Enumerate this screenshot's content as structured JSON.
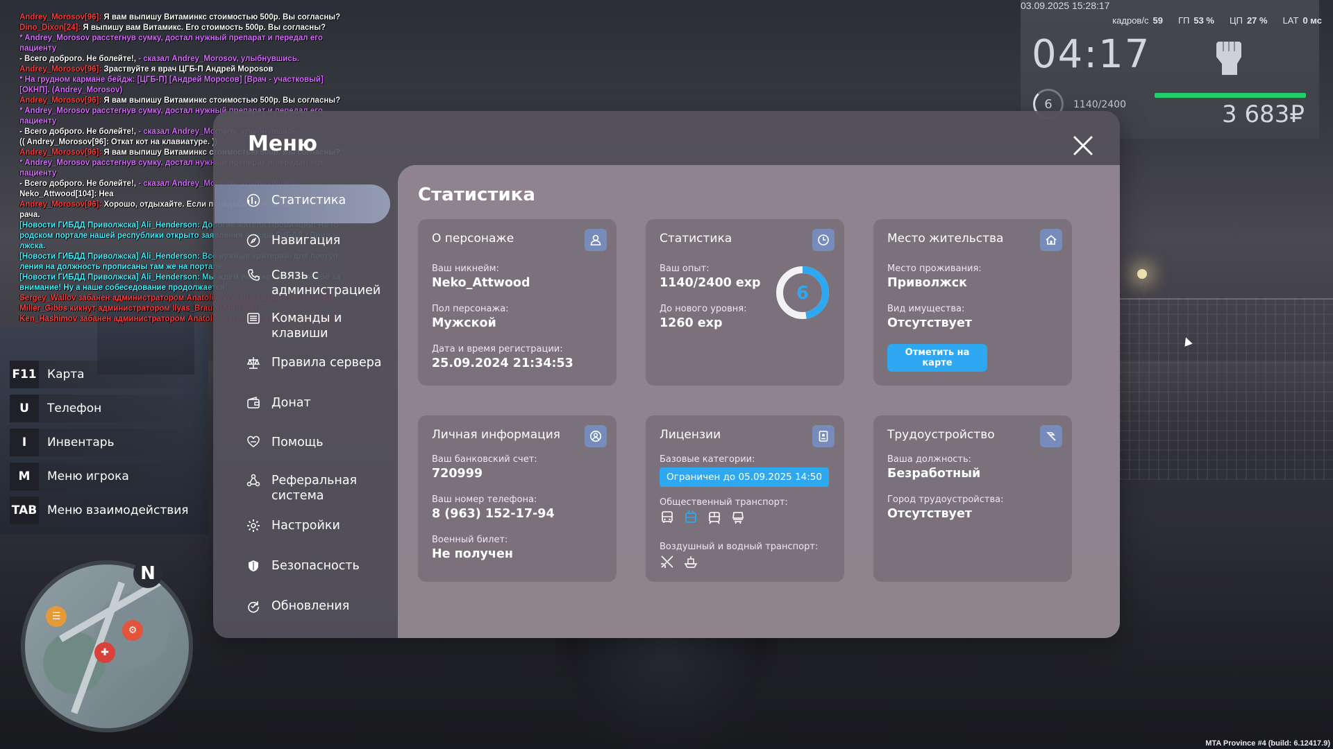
{
  "hud": {
    "datetime": "03.09.2025 15:28:17",
    "fps_label": "кадров/с",
    "fps": "59",
    "gpu_label": "ГП",
    "gpu": "53 %",
    "cpu_label": "ЦП",
    "cpu": "27 %",
    "lat_label": "LAT",
    "lat": "0 мс",
    "time": "04:17",
    "level": "6",
    "exp": "1140/2400",
    "money": "3 683₽",
    "health_fraction": 1.0,
    "health_color": "#1fd06a"
  },
  "chat": [
    {
      "segments": [
        {
          "t": "Andrey_Morosov[96]:",
          "c": "red"
        },
        {
          "t": " Я вам выпишу Витаминкс стоимостью 500р. Вы согласны?",
          "c": "white"
        }
      ]
    },
    {
      "segments": [
        {
          "t": "Dino_Dixon[24]:",
          "c": "red"
        },
        {
          "t": " Я выпишу вам Витамикс. Его стоимость 500р. Вы согласны?",
          "c": "white"
        }
      ]
    },
    {
      "segments": [
        {
          "t": "* Andrey_Morosov расстегнув сумку, достал нужный препарат и передал его пациенту",
          "c": "pink"
        }
      ]
    },
    {
      "segments": [
        {
          "t": "- Всего доброго. Не болейте!, ",
          "c": "white"
        },
        {
          "t": "- сказал Andrey_Morosov, улыбнувшись.",
          "c": "pink"
        }
      ]
    },
    {
      "segments": [
        {
          "t": "Andrey_Morosov[96]:",
          "c": "red"
        },
        {
          "t": " Зраствуйте я врач ЦГБ-П Андрей Морosов",
          "c": "white"
        }
      ]
    },
    {
      "segments": [
        {
          "t": "* На грудном кармане бейдж: [ЦГБ-П] [Андрей Моросов] [Врач - участковый] [ОКНП]. (Andrey_Morosov)",
          "c": "pink"
        }
      ]
    },
    {
      "segments": [
        {
          "t": "Andrey_Morosov[96]:",
          "c": "red"
        },
        {
          "t": " Я вам выпишу Витаминкс стоимостью 500р. Вы согласны?",
          "c": "white"
        }
      ]
    },
    {
      "segments": [
        {
          "t": "* Andrey_Morosov расстегнув сумку, достал нужный препарат и передал его пациенту",
          "c": "pink"
        }
      ]
    },
    {
      "segments": [
        {
          "t": "- Всего доброго. Не болейте!, ",
          "c": "white"
        },
        {
          "t": "- сказал Andrey_Morosov, улыбнувшись.",
          "c": "pink"
        }
      ]
    },
    {
      "segments": [
        {
          "t": "(( Andrey_Morosov[96]: Откат кот на клавиатуре. ))",
          "c": "white"
        }
      ]
    },
    {
      "segments": [
        {
          "t": "Andrey_Morosov[96]:",
          "c": "red"
        },
        {
          "t": " Я вам выпишу Витаминкс стоимостью 500р. Вы согласны?",
          "c": "white"
        }
      ]
    },
    {
      "segments": [
        {
          "t": "* Andrey_Morosov расстегнув сумку, достал нужный препарат и передал его пациенту",
          "c": "pink"
        }
      ]
    },
    {
      "segments": [
        {
          "t": "- Всего доброго. Не болейте!, ",
          "c": "white"
        },
        {
          "t": "- сказал Andrey_Morosov, улыбнувшись.",
          "c": "pink"
        }
      ]
    },
    {
      "segments": [
        {
          "t": "Neko_Attwood[104]: Неа",
          "c": "white"
        }
      ]
    },
    {
      "segments": [
        {
          "t": "Andrey_Morosov[96]:",
          "c": "red"
        },
        {
          "t": " Хорошо, отдыхайте. Если понадобится помощь - зовите в рача.",
          "c": "white"
        }
      ]
    },
    {
      "segments": [
        {
          "t": "[Новости ГИБДД Приволжска] Ali_Henderson: Дорогие жители Провинции! На го родском портале нашей республики открыто заявления в ряды ГИБДД г.Приво лжска.",
          "c": "cyan"
        }
      ]
    },
    {
      "segments": [
        {
          "t": "[Новости ГИБДД Приволжска] Ali_Henderson: Все нужные критерии, для поступ ления на должность прописаны там же на портале.",
          "c": "cyan"
        }
      ]
    },
    {
      "segments": [
        {
          "t": "[Новости ГИБДД Приволжска] Ali_Henderson: Мы ждём именно тебя! Спасибо за внимание! Ну а наше собеседование продолжается!",
          "c": "cyan"
        }
      ]
    },
    {
      "segments": [
        {
          "t": "Sergey_Wallov забанен администратором Anatoliy_Vercetti (3 дн.) (Cheats by Bl)",
          "c": "red"
        }
      ]
    },
    {
      "segments": [
        {
          "t": "Miller_Gibbs кикнут администратором Ilyas_Braun (AFK 30+)",
          "c": "red"
        }
      ]
    },
    {
      "segments": [
        {
          "t": "Ken_Hashimov забанен администратором Anatoliy_Vercetti (3 дн.) (Cheats by Mill)",
          "c": "red"
        }
      ]
    }
  ],
  "keybinds": [
    {
      "key": "F11",
      "label": "Карта"
    },
    {
      "key": "U",
      "label": "Телефон"
    },
    {
      "key": "I",
      "label": "Инвентарь"
    },
    {
      "key": "M",
      "label": "Меню игрока"
    },
    {
      "key": "TAB",
      "label": "Меню взаимодействия"
    }
  ],
  "minimap": {
    "north": "N"
  },
  "menu": {
    "title": "Меню",
    "sidebar": [
      {
        "label": "Статистика",
        "icon": "chart-icon",
        "active": true
      },
      {
        "label": "Навигация",
        "icon": "compass-icon"
      },
      {
        "label": "Связь с администрацией",
        "icon": "phone-icon"
      },
      {
        "label": "Команды и клавиши",
        "icon": "keyboard-icon"
      },
      {
        "label": "Правила сервера",
        "icon": "scales-icon"
      },
      {
        "label": "Донат",
        "icon": "wallet-icon"
      },
      {
        "label": "Помощь",
        "icon": "heart-hand-icon"
      },
      {
        "label": "Реферальная система",
        "icon": "network-icon"
      },
      {
        "label": "Настройки",
        "icon": "gear-icon"
      },
      {
        "label": "Безопасность",
        "icon": "shield-icon"
      },
      {
        "label": "Обновления",
        "icon": "refresh-icon"
      }
    ]
  },
  "stats": {
    "title": "Статистика",
    "character": {
      "title": "О персонаже",
      "nickname_label": "Ваш никнейм:",
      "nickname": "Neko_Attwood",
      "gender_label": "Пол персонажа:",
      "gender": "Мужской",
      "reg_label": "Дата и время регистрации:",
      "reg": "25.09.2024 21:34:53"
    },
    "statistics": {
      "title": "Статистика",
      "exp_label": "Ваш опыт:",
      "exp": "1140/2400 exp",
      "next_label": "До нового уровня:",
      "next": "1260 exp",
      "level": "6",
      "progress": 0.475
    },
    "residence": {
      "title": "Место жительства",
      "place_label": "Место проживания:",
      "place": "Приволжск",
      "property_label": "Вид имущества:",
      "property": "Отсутствует",
      "map_button": "Отметить на карте"
    },
    "personal": {
      "title": "Личная информация",
      "bank_label": "Ваш банковский счет:",
      "bank": "720999",
      "phone_label": "Ваш номер телефона:",
      "phone": "8 (963) 152-17-94",
      "military_label": "Военный билет:",
      "military": "Не получен"
    },
    "licenses": {
      "title": "Лицензии",
      "base_label": "Базовые категории:",
      "base_status": "Ограничен до 05.09.2025 14:50",
      "public_label": "Общественный транспорт:",
      "air_label": "Воздушный и водный транспорт:"
    },
    "employment": {
      "title": "Трудоустройство",
      "position_label": "Ваша должность:",
      "position": "Безработный",
      "city_label": "Город трудоустройства:",
      "city": "Отсутствует"
    }
  },
  "footer": {
    "version": "MTA Province #4 (build: 6.12417.9)"
  },
  "colors": {
    "accent": "#2ea8f0",
    "ring_bg": "#f2f2f4",
    "ring_fg": "#2ea8f0"
  }
}
